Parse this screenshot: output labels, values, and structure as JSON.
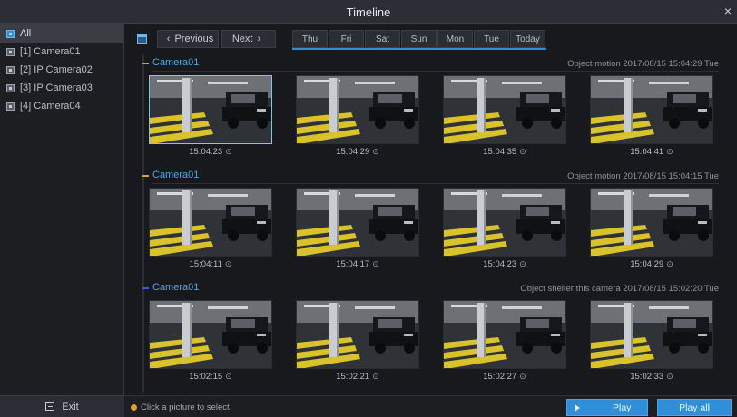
{
  "window": {
    "title": "Timeline",
    "close_glyph": "×"
  },
  "sidebar": {
    "items": [
      {
        "label": "All",
        "icon": "camera-group-icon",
        "active": true
      },
      {
        "label": "[1] Camera01",
        "icon": "camera-icon",
        "active": false
      },
      {
        "label": "[2] IP Camera02",
        "icon": "camera-icon",
        "active": false
      },
      {
        "label": "[3] IP Camera03",
        "icon": "camera-icon",
        "active": false
      },
      {
        "label": "[4] Camera04",
        "icon": "camera-icon",
        "active": false
      }
    ],
    "exit_label": "Exit"
  },
  "nav": {
    "previous_label": "Previous",
    "next_label": "Next",
    "prev_glyph": "‹",
    "next_glyph": "›",
    "days": [
      "Thu",
      "Fri",
      "Sat",
      "Sun",
      "Mon",
      "Tue",
      "Today"
    ],
    "accent": "#2f8fd8"
  },
  "sections": [
    {
      "camera": "Camera01",
      "event": "Object motion 2017/08/15 15:04:29 Tue",
      "marker_color": "#e0a030",
      "times": [
        "15:04:23",
        "15:04:29",
        "15:04:35",
        "15:04:41"
      ]
    },
    {
      "camera": "Camera01",
      "event": "Object motion 2017/08/15 15:04:15 Tue",
      "marker_color": "#e0a030",
      "times": [
        "15:04:11",
        "15:04:17",
        "15:04:23",
        "15:04:29"
      ]
    },
    {
      "camera": "Camera01",
      "event": "Object shelter this camera 2017/08/15 15:02:20 Tue",
      "marker_color": "#3b5bd6",
      "times": [
        "15:02:15",
        "15:02:21",
        "15:02:27",
        "15:02:33"
      ]
    }
  ],
  "clock_glyph": "⊙",
  "footer": {
    "hint": "Click a picture to select",
    "play_label": "Play",
    "play_all_label": "Play all"
  }
}
